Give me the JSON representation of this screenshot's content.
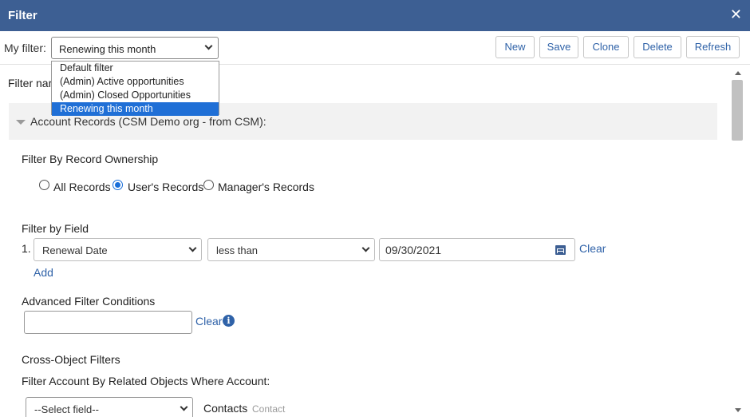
{
  "window": {
    "title": "Filter",
    "close_glyph": "✕"
  },
  "toolbar": {
    "my_filter_label": "My filter:",
    "selected_filter": "Renewing this month",
    "buttons": {
      "new": "New",
      "save": "Save",
      "clone": "Clone",
      "delete": "Delete",
      "refresh": "Refresh"
    }
  },
  "filter_dropdown": {
    "options": [
      "Default filter",
      "(Admin) Active opportunities",
      "(Admin) Closed Opportunities",
      "Renewing this month"
    ],
    "selected_index": 3
  },
  "form": {
    "filter_name_label": "Filter nar",
    "section_title": "Account Records (CSM Demo org - from CSM):",
    "ownership": {
      "heading": "Filter By Record Ownership",
      "options": [
        "All Records",
        "User's Records",
        "Manager's Records"
      ],
      "selected": "User's Records"
    },
    "by_field": {
      "heading": "Filter by Field",
      "row_number": "1.",
      "field": "Renewal Date",
      "operator": "less than",
      "value": "09/30/2021",
      "clear_label": "Clear",
      "add_label": "Add"
    },
    "advanced": {
      "heading": "Advanced Filter Conditions",
      "value": "",
      "clear_label": "Clear"
    },
    "cross_object": {
      "heading": "Cross-Object Filters",
      "subheading": "Filter Account By Related Objects Where Account:",
      "select_placeholder": "--Select field--",
      "object_label": "Contacts",
      "object_hint": "Contact"
    }
  },
  "icons": {
    "close": "close-icon",
    "calendar": "calendar-icon",
    "info": "info-icon",
    "collapse": "triangle-down-icon"
  }
}
